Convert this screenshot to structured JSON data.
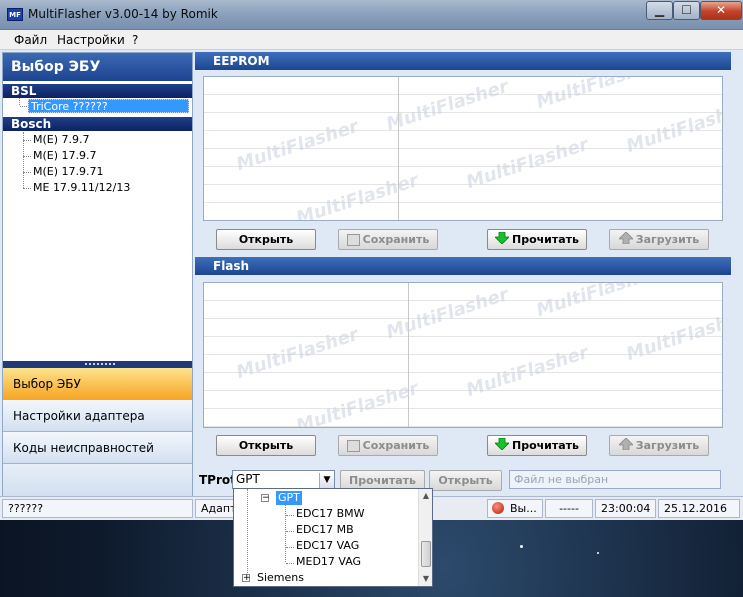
{
  "window": {
    "app_icon": "MF",
    "title": "MultiFlasher v3.00-14 by Romik",
    "min_glyph": "▁",
    "max_glyph": "☐",
    "close_glyph": "✕"
  },
  "menu": {
    "items": [
      "Файл",
      "Настройки",
      "?"
    ]
  },
  "left": {
    "header": "Выбор ЭБУ",
    "groups": [
      {
        "title": "BSL",
        "items": [
          "TriCore ??????"
        ]
      },
      {
        "title": "Bosch",
        "items": [
          "M(E) 7.9.7",
          "M(E) 17.9.7",
          "M(E) 17.9.71",
          "ME 17.9.11/12/13"
        ]
      }
    ],
    "nav": [
      "Выбор ЭБУ",
      "Настройки адаптера",
      "Коды неисправностей"
    ]
  },
  "eeprom": {
    "title": "EEPROM",
    "watermark": "MultiFlasher",
    "buttons": {
      "open": "Открыть",
      "save": "Сохранить",
      "read": "Прочитать",
      "write": "Загрузить"
    }
  },
  "flash": {
    "title": "Flash",
    "watermark": "MultiFlasher",
    "buttons": {
      "open": "Открыть",
      "save": "Сохранить",
      "read": "Прочитать",
      "write": "Загрузить"
    }
  },
  "tprot": {
    "label": "TProt",
    "selected": "GPT",
    "read": "Прочитать",
    "open": "Открыть",
    "file": "Файл не выбран"
  },
  "status": {
    "left": "??????",
    "adapter": "Адапте",
    "conn": "Вы...",
    "dashes": "-----",
    "time": "23:00:04",
    "date": "25.12.2016"
  },
  "dropdown": {
    "parent": "GPT",
    "children": [
      "EDC17 BMW",
      "EDC17 MB",
      "EDC17 VAG",
      "MED17 VAG"
    ],
    "next": "Siemens"
  },
  "colors": {
    "accent": "#1e4490",
    "nav_active": "#f7a623",
    "read_arrow": "#17c22a"
  }
}
